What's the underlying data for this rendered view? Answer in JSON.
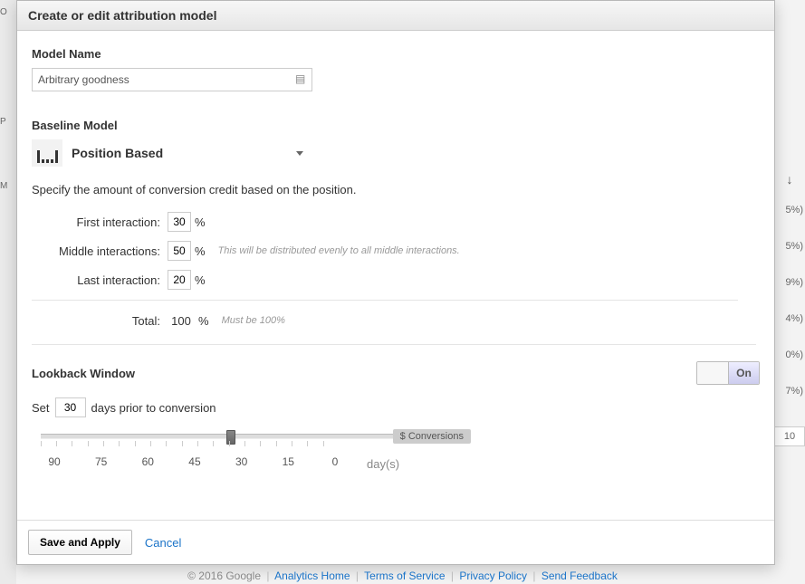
{
  "header": {
    "title": "Create or edit attribution model"
  },
  "modelName": {
    "label": "Model Name",
    "value": "Arbitrary goodness"
  },
  "baseline": {
    "label": "Baseline Model",
    "selected": "Position Based",
    "description": "Specify the amount of conversion credit based on the position.",
    "rows": {
      "first": {
        "label": "First interaction:",
        "value": "30",
        "unit": "%"
      },
      "middle": {
        "label": "Middle interactions:",
        "value": "50",
        "unit": "%",
        "hint": "This will be distributed evenly to all middle interactions."
      },
      "last": {
        "label": "Last interaction:",
        "value": "20",
        "unit": "%"
      }
    },
    "total": {
      "label": "Total:",
      "value": "100",
      "unit": "%",
      "hint": "Must be 100%"
    }
  },
  "lookback": {
    "label": "Lookback Window",
    "toggleOn": "On",
    "setPrefix": "Set",
    "days": "30",
    "setSuffix": "days prior to conversion",
    "sliderBadge": "$ Conversions",
    "ticks": [
      "90",
      "75",
      "60",
      "45",
      "30",
      "15",
      "0"
    ],
    "daysUnit": "day(s)"
  },
  "footer": {
    "save": "Save and Apply",
    "cancel": "Cancel"
  },
  "pageFooter": {
    "copyright": "© 2016 Google",
    "links": [
      "Analytics Home",
      "Terms of Service",
      "Privacy Policy",
      "Send Feedback"
    ]
  },
  "bgRight": {
    "pcts": [
      "5%)",
      "5%)",
      "9%)",
      "4%)",
      "0%)",
      "7%)"
    ],
    "num": "10"
  }
}
